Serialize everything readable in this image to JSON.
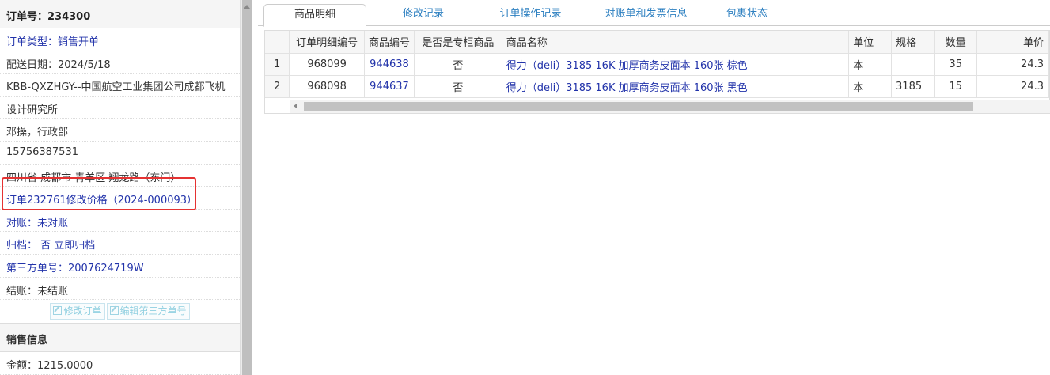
{
  "order": {
    "header": "订单号：234300",
    "type": "订单类型：销售开单",
    "delivery_date": "配送日期：2024/5/18",
    "customer_line1": "KBB-QXZHGY--中国航空工业集团公司成都飞机",
    "customer_line2": "设计研究所",
    "contact": "邓操，行政部",
    "phone": "15756387531",
    "address": "四川省 成都市 青羊区 翔龙路（东门）",
    "price_change": "订单232761修改价格（2024-000093）",
    "reconcile": "对账：未对账",
    "archive": "归档：  否 立即归档",
    "third_party_no": "第三方单号：2007624719W",
    "settle": "结账：未结账",
    "btn_edit_order": "修改订单",
    "btn_edit_third": "编辑第三方单号",
    "sales_header": "销售信息",
    "amount": "金额：1215.0000"
  },
  "tabs": [
    "商品明细",
    "修改记录",
    "订单操作记录",
    "对账单和发票信息",
    "包裹状态"
  ],
  "table": {
    "columns": [
      "订单明细编号",
      "商品编号",
      "是否是专柜商品",
      "商品名称",
      "单位",
      "规格",
      "数量",
      "单价"
    ],
    "rows": [
      {
        "num": "1",
        "detail_no": "968099",
        "product_no": "944638",
        "counter": "否",
        "name": "得力（deli）3185 16K 加厚商务皮面本 160张 棕色",
        "unit": "本",
        "spec": "",
        "qty": "35",
        "price": "24.3"
      },
      {
        "num": "2",
        "detail_no": "968098",
        "product_no": "944637",
        "counter": "否",
        "name": "得力（deli）3185 16K 加厚商务皮面本 160张 黑色",
        "unit": "本",
        "spec": "3185",
        "qty": "15",
        "price": "24.3"
      }
    ]
  },
  "colors": {
    "link": "#2233aa",
    "tab": "#2c7fc0",
    "highlight": "#e53232"
  }
}
